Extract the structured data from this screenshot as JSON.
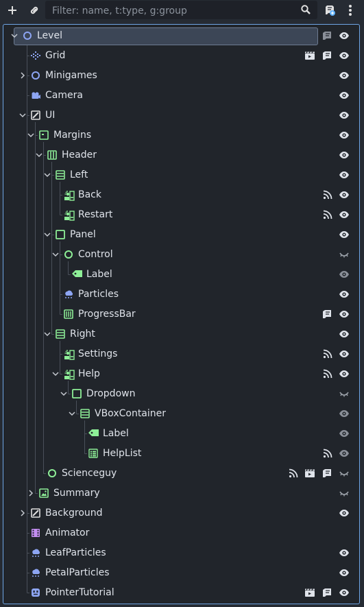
{
  "toolbar": {
    "add_icon": "plus-icon",
    "link_icon": "link-icon",
    "filter_placeholder": "Filter: name, t:type, g:group",
    "search_icon": "search-icon",
    "script_icon": "add-script-icon",
    "menu_icon": "kebab-menu-icon"
  },
  "colors": {
    "background": "#262b33",
    "tree_bg": "#21252b",
    "accent_border": "#6fa6e6",
    "node2d_blue": "#8da5f3",
    "control_green": "#8eef97",
    "spatial_red": "#fc7f7f",
    "animation_purple": "#c38ef1"
  },
  "nodes": [
    {
      "name": "Level",
      "depth": 0,
      "expanded": true,
      "icon": "node2d-icon",
      "selected": true,
      "script": true,
      "visible": "eye-open"
    },
    {
      "name": "Grid",
      "depth": 1,
      "icon": "tilemap-icon",
      "scene": true,
      "script": true,
      "visible": "eye-open"
    },
    {
      "name": "Minigames",
      "depth": 1,
      "collapsed": true,
      "icon": "node2d-icon",
      "visible": "eye-open"
    },
    {
      "name": "Camera",
      "depth": 1,
      "icon": "camera2d-icon",
      "visible": "eye-open"
    },
    {
      "name": "UI",
      "depth": 1,
      "expanded": true,
      "icon": "canvaslayer-icon",
      "visible": "eye-open"
    },
    {
      "name": "Margins",
      "depth": 2,
      "expanded": true,
      "icon": "margincontainer-icon",
      "visible": "eye-open"
    },
    {
      "name": "Header",
      "depth": 3,
      "expanded": true,
      "icon": "hboxcontainer-icon",
      "visible": "eye-open"
    },
    {
      "name": "Left",
      "depth": 4,
      "expanded": true,
      "icon": "vboxcontainer-icon",
      "visible": "eye-open"
    },
    {
      "name": "Back",
      "depth": 5,
      "icon": "button-icon",
      "signal": true,
      "visible": "eye-open"
    },
    {
      "name": "Restart",
      "depth": 5,
      "icon": "button-icon",
      "signal": true,
      "visible": "eye-open"
    },
    {
      "name": "Panel",
      "depth": 4,
      "expanded": true,
      "icon": "panel-icon",
      "visible": "eye-open"
    },
    {
      "name": "Control",
      "depth": 5,
      "expanded": true,
      "icon": "control-icon",
      "visible": "eye-closed"
    },
    {
      "name": "Label",
      "depth": 6,
      "icon": "label-icon",
      "visible": "eye-dim"
    },
    {
      "name": "Particles",
      "depth": 5,
      "icon": "particles-icon",
      "visible": "eye-open"
    },
    {
      "name": "ProgressBar",
      "depth": 5,
      "icon": "progressbar-icon",
      "script": true,
      "visible": "eye-open"
    },
    {
      "name": "Right",
      "depth": 4,
      "expanded": true,
      "icon": "vboxcontainer-icon",
      "visible": "eye-open"
    },
    {
      "name": "Settings",
      "depth": 5,
      "icon": "button-icon",
      "signal": true,
      "visible": "eye-open"
    },
    {
      "name": "Help",
      "depth": 5,
      "expanded": true,
      "icon": "button-icon",
      "signal": true,
      "visible": "eye-open"
    },
    {
      "name": "Dropdown",
      "depth": 6,
      "expanded": true,
      "icon": "panel-icon",
      "visible": "eye-closed"
    },
    {
      "name": "VBoxContainer",
      "depth": 7,
      "expanded": true,
      "icon": "vboxcontainer-icon",
      "visible": "eye-dim"
    },
    {
      "name": "Label",
      "depth": 8,
      "icon": "label-icon",
      "visible": "eye-dim"
    },
    {
      "name": "HelpList",
      "depth": 8,
      "icon": "itemlist-icon",
      "signal": true,
      "visible": "eye-dim"
    },
    {
      "name": "Scienceguy",
      "depth": 3,
      "icon": "control-icon",
      "signal": true,
      "scene": true,
      "script": true,
      "visible": "eye-closed"
    },
    {
      "name": "Summary",
      "depth": 2,
      "collapsed": true,
      "icon": "texturerect-icon",
      "visible": "eye-closed"
    },
    {
      "name": "Background",
      "depth": 1,
      "collapsed": true,
      "icon": "canvaslayer-icon",
      "visible": "eye-open"
    },
    {
      "name": "Animator",
      "depth": 1,
      "icon": "animationplayer-icon"
    },
    {
      "name": "LeafParticles",
      "depth": 1,
      "icon": "particles-icon",
      "visible": "eye-open"
    },
    {
      "name": "PetalParticles",
      "depth": 1,
      "icon": "particles-icon",
      "visible": "eye-open"
    },
    {
      "name": "PointerTutorial",
      "depth": 1,
      "icon": "sprite-icon",
      "scene": true,
      "script": true,
      "visible": "eye-open"
    }
  ]
}
